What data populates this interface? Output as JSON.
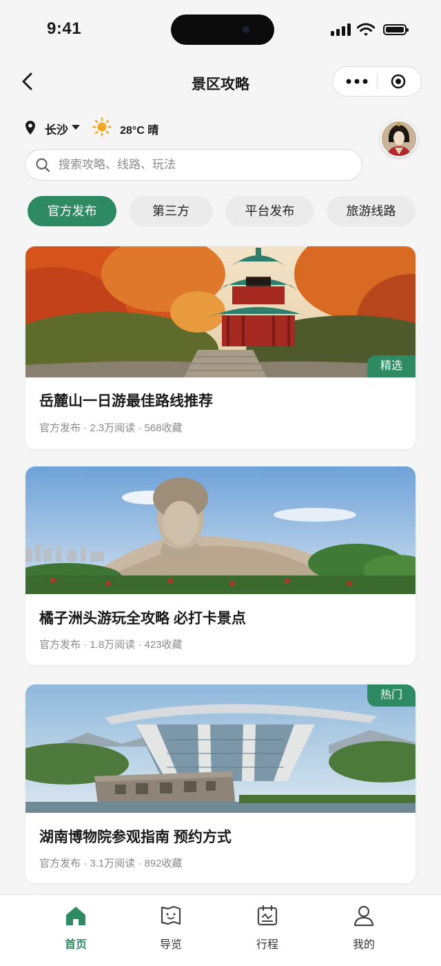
{
  "status_bar": {
    "time": "9:41"
  },
  "nav": {
    "title": "景区攻略"
  },
  "location": {
    "city": "长沙",
    "weather": "28°C 晴"
  },
  "search": {
    "placeholder": "搜索攻略、线路、玩法"
  },
  "tabs": [
    {
      "label": "官方发布",
      "active": true
    },
    {
      "label": "第三方",
      "active": false
    },
    {
      "label": "平台发布",
      "active": false
    },
    {
      "label": "旅游线路",
      "active": false
    }
  ],
  "articles": [
    {
      "title": "岳麓山一日游最佳路线推荐",
      "meta": "官方发布 · 2.3万阅读 · 568收藏",
      "tag": "精选"
    },
    {
      "title": "橘子洲头游玩全攻略 必打卡景点",
      "meta": "官方发布 · 1.8万阅读 · 423收藏"
    },
    {
      "title": "湖南博物院参观指南 预约方式",
      "meta": "官方发布 · 3.1万阅读 · 892收藏",
      "tag": "热门"
    }
  ],
  "bottom_nav": [
    {
      "label": "首页",
      "icon": "home-icon",
      "active": true
    },
    {
      "label": "导览",
      "icon": "map-guide-icon",
      "active": false
    },
    {
      "label": "行程",
      "icon": "itinerary-icon",
      "active": false
    },
    {
      "label": "我的",
      "icon": "profile-icon",
      "active": false
    }
  ],
  "colors": {
    "accent": "#2e8a63",
    "background": "#f4f5f4"
  }
}
